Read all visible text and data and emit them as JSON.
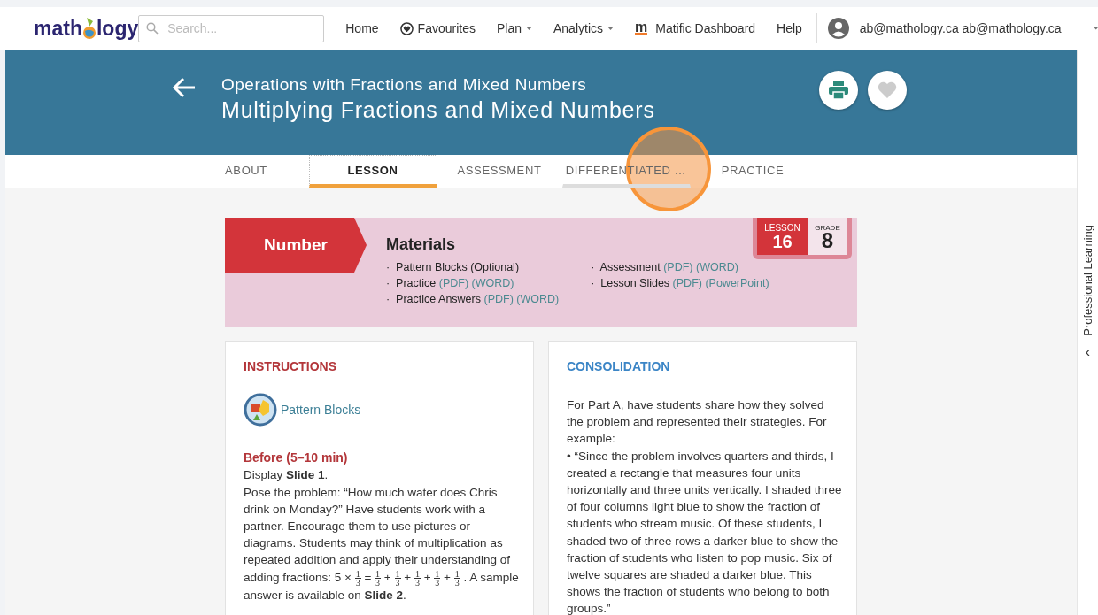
{
  "nav": {
    "logo": [
      "math",
      "logy"
    ],
    "search": {
      "placeholder": "Search..."
    },
    "items": [
      {
        "label": "Home",
        "kind": "plain"
      },
      {
        "label": "Favourites",
        "kind": "heart"
      },
      {
        "label": "Plan",
        "kind": "dropdown"
      },
      {
        "label": "Analytics",
        "kind": "dropdown"
      },
      {
        "label": "Matific Dashboard",
        "kind": "brand",
        "mark": "m"
      },
      {
        "label": "Help",
        "kind": "plain"
      }
    ],
    "user": "ab@mathology.ca ab@mathology.ca"
  },
  "header": {
    "subtitle": "Operations with Fractions and Mixed Numbers",
    "title": "Multiplying Fractions and Mixed Numbers"
  },
  "tabs": [
    {
      "label": "ABOUT",
      "selected": false,
      "hovered": false
    },
    {
      "label": "LESSON",
      "selected": true,
      "hovered": false
    },
    {
      "label": "ASSESSMENT",
      "selected": false,
      "hovered": false
    },
    {
      "label": "DIFFERENTIATED …",
      "selected": false,
      "hovered": true
    },
    {
      "label": "PRACTICE",
      "selected": false,
      "hovered": false
    }
  ],
  "click_indicator": true,
  "materials": {
    "strand": "Number",
    "heading": "Materials",
    "columns": [
      [
        {
          "name": "·  Pattern Blocks (Optional)"
        },
        {
          "name": "·  Practice",
          "links": [
            "(PDF)",
            "(WORD)"
          ]
        },
        {
          "name": "·  Practice Answers",
          "links": [
            "(PDF)",
            "(WORD)"
          ]
        }
      ],
      [
        {
          "name": "·  Assessment",
          "links": [
            "(PDF)",
            "(WORD)"
          ]
        },
        {
          "name": "·  Lesson Slides",
          "links": [
            "(PDF)",
            "(PowerPoint)"
          ]
        }
      ]
    ],
    "lesson_label": "LESSON",
    "lesson": "16",
    "grade_label": "GRADE",
    "grade": "8"
  },
  "instructions": {
    "heading": "INSTRUCTIONS",
    "tool": "Pattern Blocks",
    "phase": "Before (5–10 min)",
    "line": "Display **Slide 1**.",
    "paragraph": [
      {
        "kind": "text",
        "text": "Pose the problem: “How much water does Chris drink on Monday?” Have students work with a partner. Encourage them to use pictures or diagrams. Students may think of multiplication as repeated addition and apply their understanding of adding fractions: 5 × "
      },
      {
        "kind": "fraction",
        "num": "1",
        "den": "3"
      },
      {
        "kind": "text",
        "text": " = "
      },
      {
        "kind": "fraction",
        "num": "1",
        "den": "3"
      },
      {
        "kind": "text",
        "text": " + "
      },
      {
        "kind": "fraction",
        "num": "1",
        "den": "3"
      },
      {
        "kind": "text",
        "text": " + "
      },
      {
        "kind": "fraction",
        "num": "1",
        "den": "3"
      },
      {
        "kind": "text",
        "text": " + "
      },
      {
        "kind": "fraction",
        "num": "1",
        "den": "3"
      },
      {
        "kind": "text",
        "text": " + "
      },
      {
        "kind": "fraction",
        "num": "1",
        "den": "3"
      },
      {
        "kind": "text",
        "text": " . A sample answer is available on **Slide 2**."
      }
    ]
  },
  "consolidation": {
    "heading": "CONSOLIDATION",
    "intro": "For Part A, have students share how they solved the problem and represented their strategies. For example:",
    "bullet": "• “Since the problem involves quarters and thirds, I created a rectangle that measures four units horizontally and three units vertically. I shaded three of four columns light blue to show the fraction of students who stream music. Of these students, I shaded two of three rows a darker blue to show the fraction of students who listen to pop music. Six of twelve squares are shaded a darker blue. This shows the fraction of students who belong to both groups.”"
  },
  "side_panel": {
    "label": "Professional Learning",
    "toggle": "‹"
  }
}
